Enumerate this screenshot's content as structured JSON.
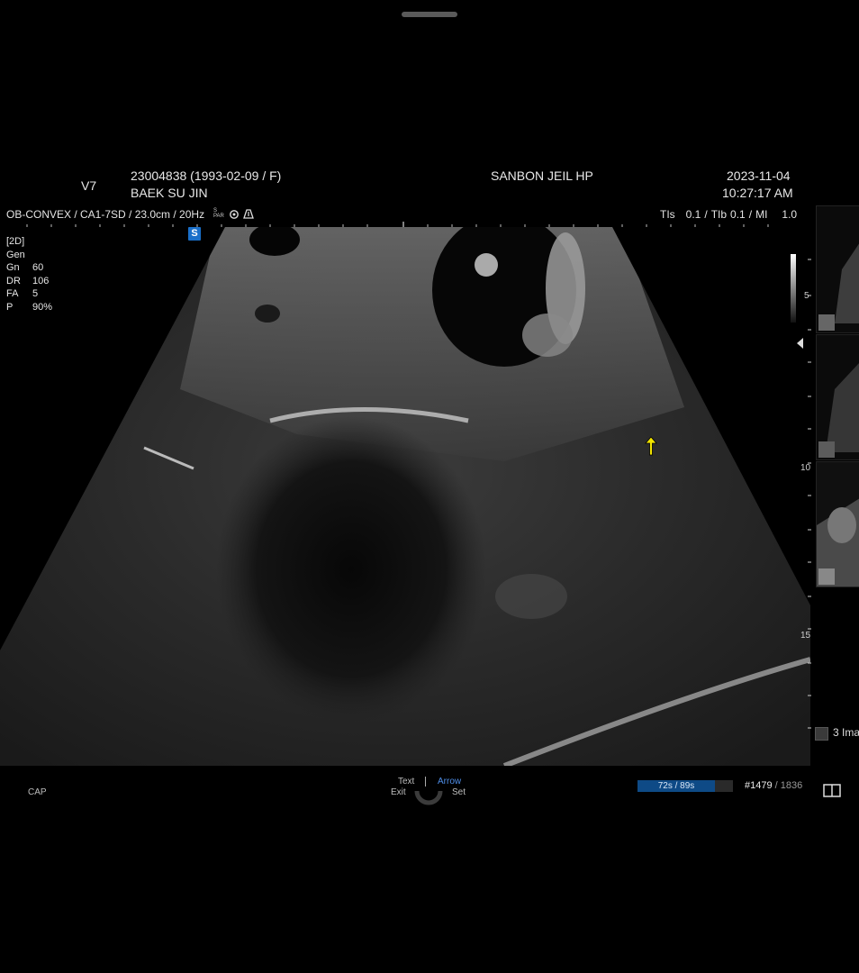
{
  "header": {
    "app_version": "V7",
    "patient_id_line": "23004838 (1993-02-09 / F)",
    "patient_name": "BAEK SU JIN",
    "hospital": "SANBON JEIL HP",
    "date": "2023-11-04",
    "time": "10:27:17 AM"
  },
  "probe_line": {
    "preset": "OB-CONVEX / CA1-7SD / 23.0cm / 20Hz",
    "small_label": "S\nPAR",
    "tis_label": "TIs",
    "tis_value": "0.1",
    "tib_label": "TIb",
    "tib_value": "0.1",
    "mi_label": "MI",
    "mi_value": "1.0"
  },
  "image_params": {
    "mode": "[2D]",
    "gen": "Gen",
    "rows": [
      {
        "key": "Gn",
        "value": "60"
      },
      {
        "key": "DR",
        "value": "106"
      },
      {
        "key": "FA",
        "value": "5"
      },
      {
        "key": "P",
        "value": "90%"
      }
    ]
  },
  "s_badge": "S",
  "depth_marks": {
    "d5": "5",
    "d10": "10",
    "d15": "15"
  },
  "thumbnails": {
    "count_label": "3 Ima"
  },
  "footer": {
    "cap": "CAP",
    "text": "Text",
    "arrow": "Arrow",
    "exit": "Exit",
    "set": "Set",
    "cine_label": "72s / 89s",
    "cine_fraction": 0.81,
    "frame_current": "#1479",
    "frame_total": "/ 1836"
  },
  "colors": {
    "accent_blue": "#1a6fc9",
    "cine_blue": "#0e4a86",
    "arrow_yellow": "#f2e400",
    "arrow_text_blue": "#4f8ee8"
  }
}
